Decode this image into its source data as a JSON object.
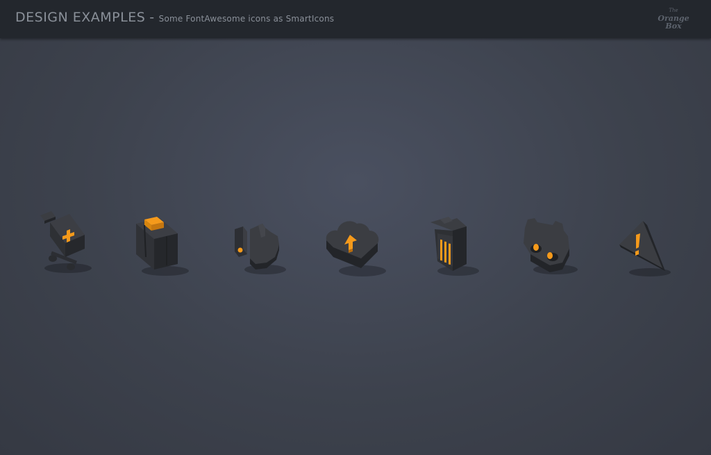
{
  "header": {
    "title": "DESIGN EXAMPLES",
    "separator": "-",
    "subtitle": "Some FontAwesome icons as SmartIcons",
    "logo_line1": "The",
    "logo_line2": "Orange Box"
  },
  "colors": {
    "accent": "#f59a1b",
    "icon_top": "#3b3d42",
    "icon_side": "#25272b",
    "background": "#3d424d",
    "topbar": "#23272d"
  },
  "icons": [
    {
      "name": "cart-plus-icon"
    },
    {
      "name": "briefcase-icon"
    },
    {
      "name": "thumbs-up-icon"
    },
    {
      "name": "cloud-upload-icon"
    },
    {
      "name": "trash-icon"
    },
    {
      "name": "gamepad-icon"
    },
    {
      "name": "warning-icon"
    }
  ]
}
